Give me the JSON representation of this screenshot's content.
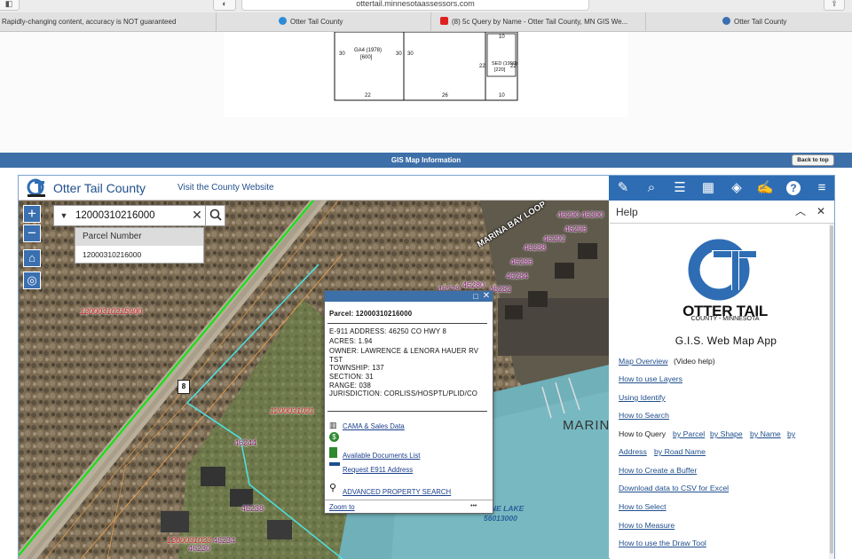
{
  "browser": {
    "url": "ottertail.minnesotaassessors.com",
    "tabs": [
      {
        "title": "Rapidly-changing content, accuracy is NOT guaranteed"
      },
      {
        "title": "Otter Tail County"
      },
      {
        "title": "(8) 5c Query by Name - Otter Tail County, MN GIS We..."
      },
      {
        "title": "Otter Tail County"
      }
    ]
  },
  "sketch": {
    "labels": {
      "ga": "GA4 (1978)",
      "ga_area": "[600]",
      "sed": "SED (1990)",
      "sed_area": "[220]",
      "d30a": "30",
      "d30b": "30",
      "d30c": "30",
      "d22a": "22",
      "d26": "26",
      "d22b": "22",
      "d22c": "22",
      "d10a": "10",
      "d10b": "10"
    }
  },
  "gis_bar": {
    "title": "GIS Map Information",
    "back_to_top": "Back to top"
  },
  "header": {
    "county_name": "Otter Tail County",
    "visit_link": "Visit the County Website"
  },
  "toolbar_icons": [
    "measure-icon",
    "identify-icon",
    "layer-list-icon",
    "basemap-icon",
    "layers-icon",
    "draw-icon",
    "help-icon",
    "menu-icon"
  ],
  "search": {
    "value": "12000310216000",
    "suggestion_header": "Parcel Number",
    "suggestion_item": "12000310216000"
  },
  "map": {
    "labels": {
      "parcel_red_1": "12000310215900",
      "parcel_red_2": "1200031021",
      "parcel_red_3": "1200031023",
      "road_shield": "8",
      "road_name": "MARINA BAY LOOP",
      "water_name": "MARIN",
      "lake_name": "NE LAKE",
      "lake_id": "56013000",
      "addresses": [
        "46290",
        "46300",
        "46296",
        "46292",
        "46288",
        "46286",
        "46284",
        "46282",
        "46280",
        "46278",
        "46244",
        "46238",
        "46234",
        "46230"
      ]
    }
  },
  "popup": {
    "parcel": "Parcel: 12000310216000",
    "e911": "E-911 ADDRESS: 46250 CO HWY 8",
    "acres": "ACRES: 1.94",
    "owner": "OWNER: LAWRENCE & LENORA HAUER RV",
    "owner2": "TST",
    "township": "TOWNSHIP: 137",
    "section": "SECTION: 31",
    "range": "RANGE: 038",
    "jurisdiction": "JURISDICTION: CORLISS/HOSPTL/PLID/CO",
    "links": {
      "cama": "CAMA & Sales Data",
      "taxes": "Property Taxes",
      "docs": "Available Documents List",
      "e911": "Request E911 Address",
      "advanced": "ADVANCED PROPERTY SEARCH"
    },
    "zoom_to": "Zoom to",
    "more": "•••"
  },
  "help": {
    "title": "Help",
    "logo_line1": "OTTER TAIL",
    "logo_line2": "COUNTY - MINNESOTA",
    "app_title": "G.I.S. Web Map App",
    "map_overview": "Map Overview",
    "video_help": "(Video help)",
    "layers": "How to use Layers",
    "identify": "Using Identify",
    "search": "How to Search",
    "query_prefix": "How to Query",
    "by_parcel": "by Parcel",
    "by_shape": "by Shape",
    "by_name": "by Name",
    "by": "by",
    "address": "Address",
    "by_road": "by Road Name",
    "buffer": "How to Create a Buffer",
    "download": "Download data to CSV for Excel",
    "select": "How to Select",
    "measure": "How to Measure",
    "draw": "How to use the Draw Tool"
  }
}
